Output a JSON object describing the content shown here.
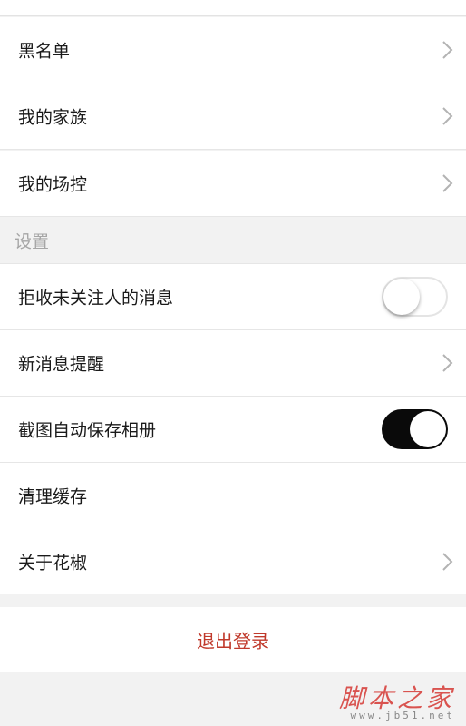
{
  "rows_top": [
    {
      "label": "黑名单",
      "icon": "chevron-right-icon"
    },
    {
      "label": "我的家族",
      "icon": "chevron-right-icon"
    },
    {
      "label": "我的场控",
      "icon": "chevron-right-icon"
    }
  ],
  "settings": {
    "header": "设置",
    "items": [
      {
        "label": "拒收未关注人的消息",
        "control": "toggle",
        "on": false
      },
      {
        "label": "新消息提醒",
        "control": "chevron",
        "icon": "chevron-right-icon"
      },
      {
        "label": "截图自动保存相册",
        "control": "toggle",
        "on": true
      },
      {
        "label": "清理缓存",
        "control": "none"
      },
      {
        "label": "关于花椒",
        "control": "chevron",
        "icon": "chevron-right-icon"
      }
    ]
  },
  "logout": {
    "label": "退出登录"
  },
  "watermark": {
    "title": "脚本之家",
    "url": "www.jb51.net"
  },
  "colors": {
    "background": "#f2f2f2",
    "row": "#ffffff",
    "text": "#1a1a1a",
    "header_text": "#a6a6a6",
    "logout_text": "#c0392b",
    "toggle_on": "#0a0a0a",
    "chevron": "#b3b3b3",
    "watermark": "#d9534f"
  }
}
